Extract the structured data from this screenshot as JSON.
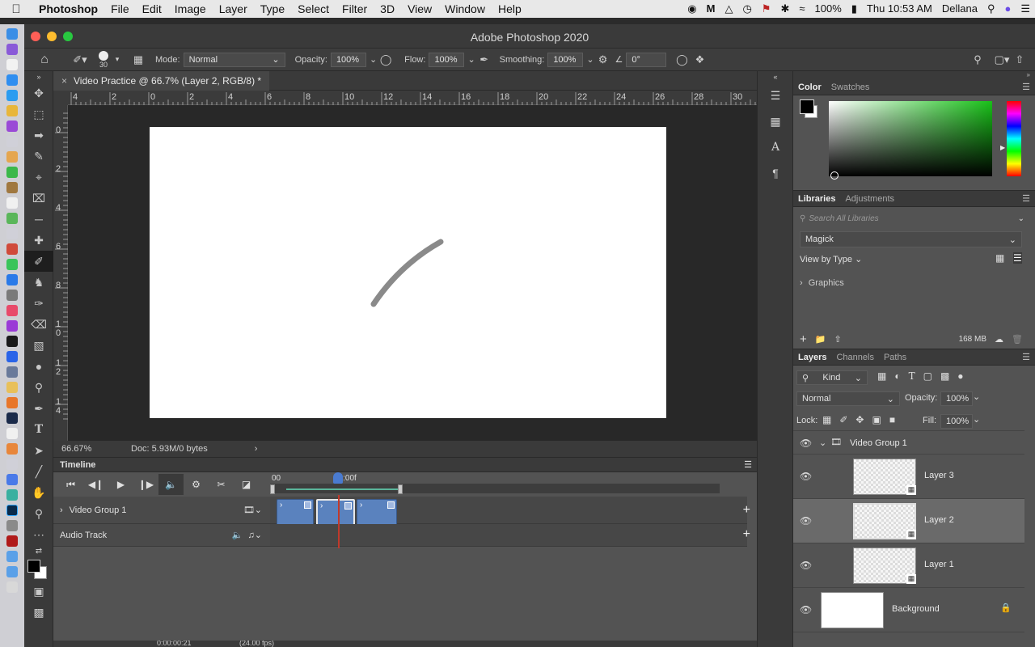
{
  "menubar": {
    "app": "Photoshop",
    "items": [
      "File",
      "Edit",
      "Image",
      "Layer",
      "Type",
      "Select",
      "Filter",
      "3D",
      "View",
      "Window",
      "Help"
    ],
    "battery": "100%",
    "clock": "Thu 10:53 AM",
    "user": "Dellana"
  },
  "window": {
    "title": "Adobe Photoshop 2020"
  },
  "options": {
    "brush_size": "30",
    "mode_label": "Mode:",
    "mode_value": "Normal",
    "opacity_label": "Opacity:",
    "opacity_value": "100%",
    "flow_label": "Flow:",
    "flow_value": "100%",
    "smoothing_label": "Smoothing:",
    "smoothing_value": "100%",
    "angle_value": "0°"
  },
  "document": {
    "tab_title": "Video Practice @ 66.7% (Layer 2, RGB/8) *",
    "ruler_h": [
      "4",
      "2",
      "0",
      "2",
      "4",
      "6",
      "8",
      "10",
      "12",
      "14",
      "16",
      "18",
      "20",
      "22",
      "24",
      "26",
      "28",
      "30"
    ],
    "ruler_v": [
      "0",
      "2",
      "4",
      "6",
      "8",
      "10",
      "12",
      "14"
    ],
    "zoom": "66.67%",
    "doc_info": "Doc: 5.93M/0 bytes"
  },
  "timeline": {
    "title": "Timeline",
    "time_start": "00",
    "time_marker": "01:00f",
    "tracks": [
      {
        "name": "Video Group 1"
      },
      {
        "name": "Audio Track"
      }
    ],
    "current_time": "0:00:00:21",
    "fps": "(24.00 fps)"
  },
  "color_panel": {
    "tabs": [
      "Color",
      "Swatches"
    ]
  },
  "libraries_panel": {
    "tabs": [
      "Libraries",
      "Adjustments"
    ],
    "search_placeholder": "Search All Libraries",
    "library": "Magick",
    "view_by": "View by Type",
    "section": "Graphics",
    "storage": "168 MB"
  },
  "layers_panel": {
    "tabs": [
      "Layers",
      "Channels",
      "Paths"
    ],
    "filter": "Kind",
    "blend_mode": "Normal",
    "opacity_label": "Opacity:",
    "opacity_value": "100%",
    "lock_label": "Lock:",
    "fill_label": "Fill:",
    "fill_value": "100%",
    "group": "Video Group 1",
    "layers": [
      {
        "name": "Layer 3"
      },
      {
        "name": "Layer 2"
      },
      {
        "name": "Layer 1"
      },
      {
        "name": "Background"
      }
    ]
  },
  "colors": {
    "accent": "#4a7bd0",
    "clip": "#5a82be",
    "playhead": "#c0392b"
  }
}
